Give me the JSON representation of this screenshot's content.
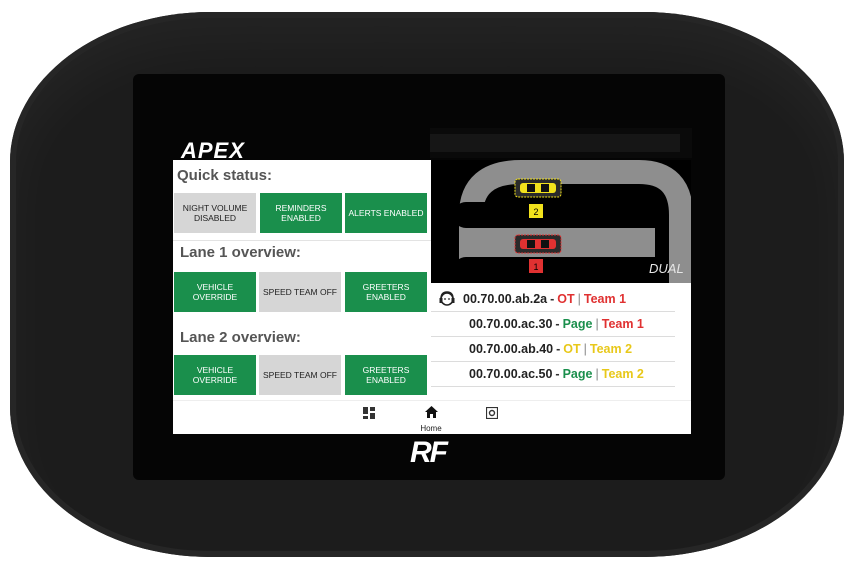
{
  "brand": {
    "logo_text": "APEX",
    "device_logo": "RF"
  },
  "quick_status": {
    "title": "Quick status:",
    "buttons": [
      {
        "label": "NIGHT VOLUME DISABLED",
        "state": "off"
      },
      {
        "label": "REMINDERS ENABLED",
        "state": "on"
      },
      {
        "label": "ALERTS ENABLED",
        "state": "on"
      }
    ]
  },
  "lane1": {
    "title": "Lane 1 overview:",
    "buttons": [
      {
        "label": "VEHICLE OVERRIDE",
        "state": "on"
      },
      {
        "label": "SPEED TEAM OFF",
        "state": "off"
      },
      {
        "label": "GREETERS ENABLED",
        "state": "on"
      }
    ]
  },
  "lane2": {
    "title": "Lane 2 overview:",
    "buttons": [
      {
        "label": "VEHICLE OVERRIDE",
        "state": "on"
      },
      {
        "label": "SPEED TEAM OFF",
        "state": "off"
      },
      {
        "label": "GREETERS ENABLED",
        "state": "on"
      }
    ]
  },
  "track": {
    "mode_label": "DUAL",
    "cars": [
      {
        "lane_number": "2",
        "color": "#f2e21c"
      },
      {
        "lane_number": "1",
        "color": "#e03131"
      }
    ]
  },
  "headsets": [
    {
      "address": "00.70.00.ab.2a",
      "status": "OT",
      "status_color": "red",
      "team": "Team 1",
      "team_color": "red",
      "has_icon": true
    },
    {
      "address": "00.70.00.ac.30",
      "status": "Page",
      "status_color": "green",
      "team": "Team 1",
      "team_color": "red",
      "has_icon": false
    },
    {
      "address": "00.70.00.ab.40",
      "status": "OT",
      "status_color": "yellow",
      "team": "Team 2",
      "team_color": "yellow",
      "has_icon": false
    },
    {
      "address": "00.70.00.ac.50",
      "status": "Page",
      "status_color": "green",
      "team": "Team 2",
      "team_color": "yellow",
      "has_icon": false
    }
  ],
  "nav": {
    "items": [
      {
        "icon": "dashboard-icon",
        "label": ""
      },
      {
        "icon": "home-icon",
        "label": "Home"
      },
      {
        "icon": "settings-icon",
        "label": ""
      }
    ]
  },
  "colors": {
    "green": "#1a8f4c",
    "gray": "#d6d6d6",
    "red": "#e03131",
    "yellow": "#e8c81a"
  }
}
